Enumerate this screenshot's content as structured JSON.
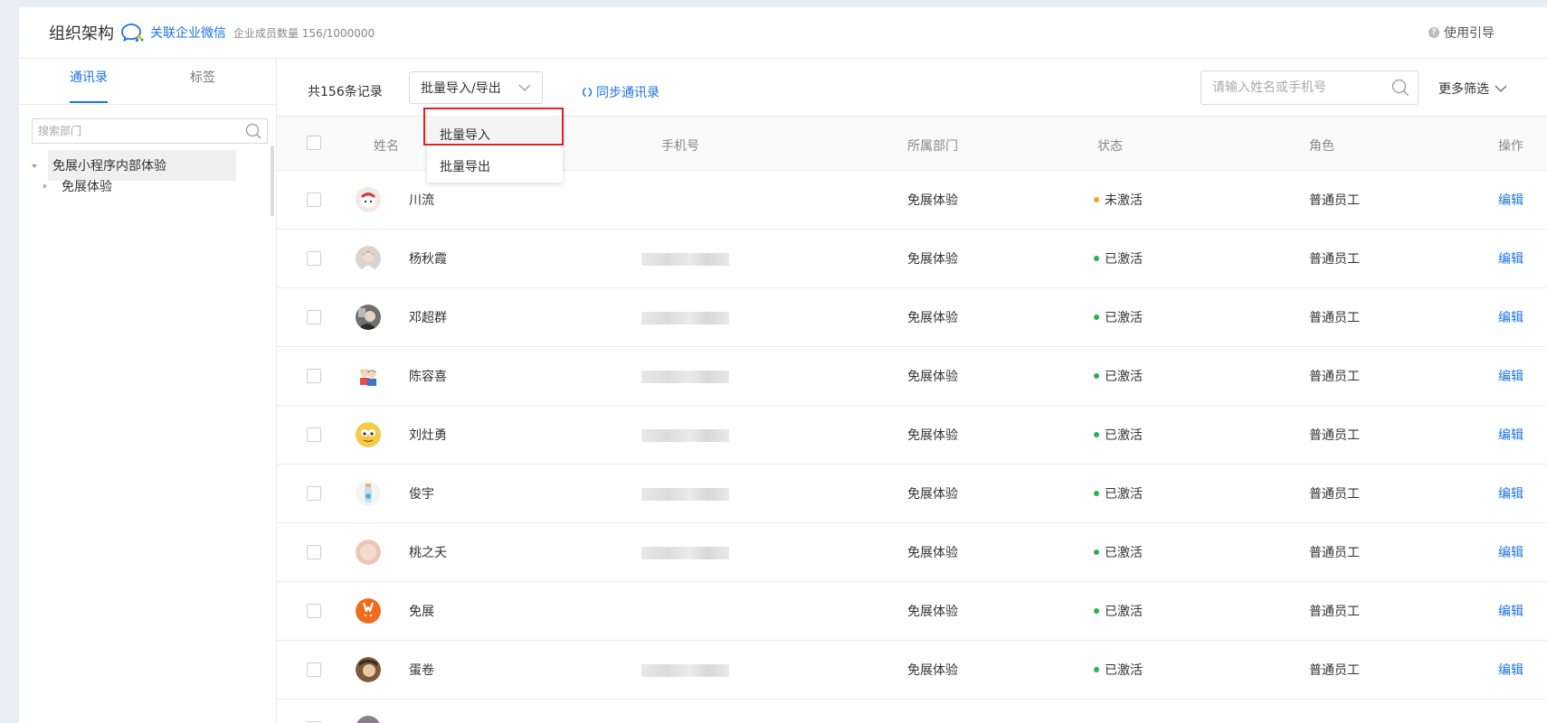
{
  "header": {
    "title": "组织架构",
    "link_wecom": "关联企业微信",
    "member_count": "企业成员数量 156/1000000",
    "guide": "使用引导"
  },
  "sidebar": {
    "tabs": [
      {
        "label": "通讯录"
      },
      {
        "label": "标签"
      }
    ],
    "search_placeholder": "搜索部门",
    "tree_root": "免展小程序内部体验",
    "tree_child": "免展体验"
  },
  "toolbar": {
    "record_count": "共156条记录",
    "batch_select": "批量导入/导出",
    "sync_link": "同步通讯录",
    "search_placeholder": "请输入姓名或手机号",
    "more_filter": "更多筛选"
  },
  "dropdown": {
    "options": [
      {
        "label": "批量导入"
      },
      {
        "label": "批量导出"
      }
    ]
  },
  "table": {
    "columns": [
      "姓名",
      "手机号",
      "所属部门",
      "状态",
      "角色",
      "操作"
    ],
    "rows": [
      {
        "name": "川流",
        "phone_shown": false,
        "dept": "免展体验",
        "status": "未激活",
        "status_color": "#f5a623",
        "role": "普通员工",
        "action": "编辑"
      },
      {
        "name": "杨秋霞",
        "phone_shown": true,
        "dept": "免展体验",
        "status": "已激活",
        "status_color": "#2bb24c",
        "role": "普通员工",
        "action": "编辑"
      },
      {
        "name": "邓超群",
        "phone_shown": true,
        "dept": "免展体验",
        "status": "已激活",
        "status_color": "#2bb24c",
        "role": "普通员工",
        "action": "编辑"
      },
      {
        "name": "陈容喜",
        "phone_shown": true,
        "dept": "免展体验",
        "status": "已激活",
        "status_color": "#2bb24c",
        "role": "普通员工",
        "action": "编辑"
      },
      {
        "name": "刘灶勇",
        "phone_shown": true,
        "dept": "免展体验",
        "status": "已激活",
        "status_color": "#2bb24c",
        "role": "普通员工",
        "action": "编辑"
      },
      {
        "name": "俊宇",
        "phone_shown": true,
        "dept": "免展体验",
        "status": "已激活",
        "status_color": "#2bb24c",
        "role": "普通员工",
        "action": "编辑"
      },
      {
        "name": "桃之夭",
        "phone_shown": true,
        "dept": "免展体验",
        "status": "已激活",
        "status_color": "#2bb24c",
        "role": "普通员工",
        "action": "编辑"
      },
      {
        "name": "免展",
        "phone_shown": false,
        "dept": "免展体验",
        "status": "已激活",
        "status_color": "#2bb24c",
        "role": "普通员工",
        "action": "编辑"
      },
      {
        "name": "蛋卷",
        "phone_shown": true,
        "dept": "免展体验",
        "status": "已激活",
        "status_color": "#2bb24c",
        "role": "普通员工",
        "action": "编辑"
      }
    ]
  },
  "colors": {
    "accent": "#1a73e8",
    "active_status": "#2bb24c",
    "inactive_status": "#f5a623",
    "highlight_box": "#e02020"
  }
}
